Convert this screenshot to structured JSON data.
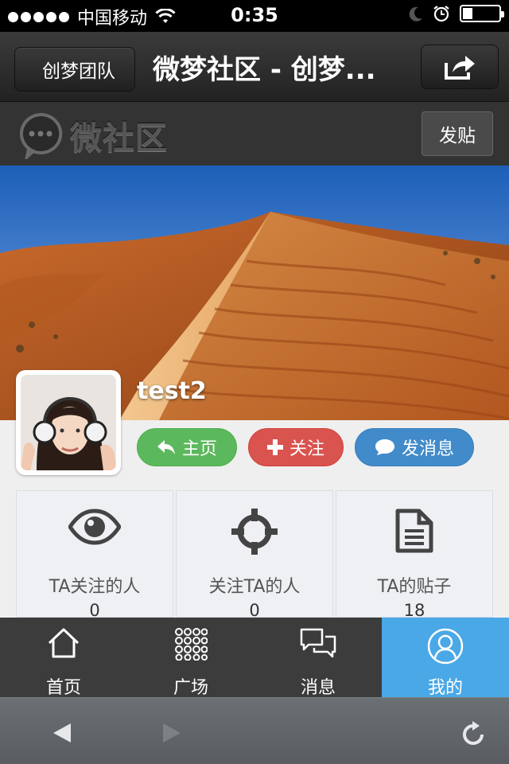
{
  "status_bar": {
    "carrier": "中国移动",
    "time": "0:35"
  },
  "nav": {
    "back_label": "创梦团队",
    "title": "微梦社区 - 创梦..."
  },
  "app": {
    "logo_text": "微社区",
    "post_label": "发贴"
  },
  "profile": {
    "username": "test2",
    "actions": [
      {
        "label": "主页",
        "icon": "reply-icon",
        "color": "#5cb85c"
      },
      {
        "label": "关注",
        "icon": "plus-icon",
        "color": "#d9534f"
      },
      {
        "label": "发消息",
        "icon": "chat-bubble-icon",
        "color": "#428bca"
      }
    ]
  },
  "stats": [
    {
      "label": "TA关注的人",
      "value": "0",
      "icon": "eye-icon"
    },
    {
      "label": "关注TA的人",
      "value": "0",
      "icon": "crosshair-icon"
    },
    {
      "label": "TA的贴子",
      "value": "18",
      "icon": "document-icon"
    }
  ],
  "tabs": [
    {
      "label": "首页",
      "icon": "home-icon",
      "active": false
    },
    {
      "label": "广场",
      "icon": "grid-icon",
      "active": false
    },
    {
      "label": "消息",
      "icon": "messages-icon",
      "active": false
    },
    {
      "label": "我的",
      "icon": "user-icon",
      "active": true
    }
  ],
  "colors": {
    "active_tab": "#4aa8e6",
    "tabbar_bg": "#3c3c3c"
  }
}
